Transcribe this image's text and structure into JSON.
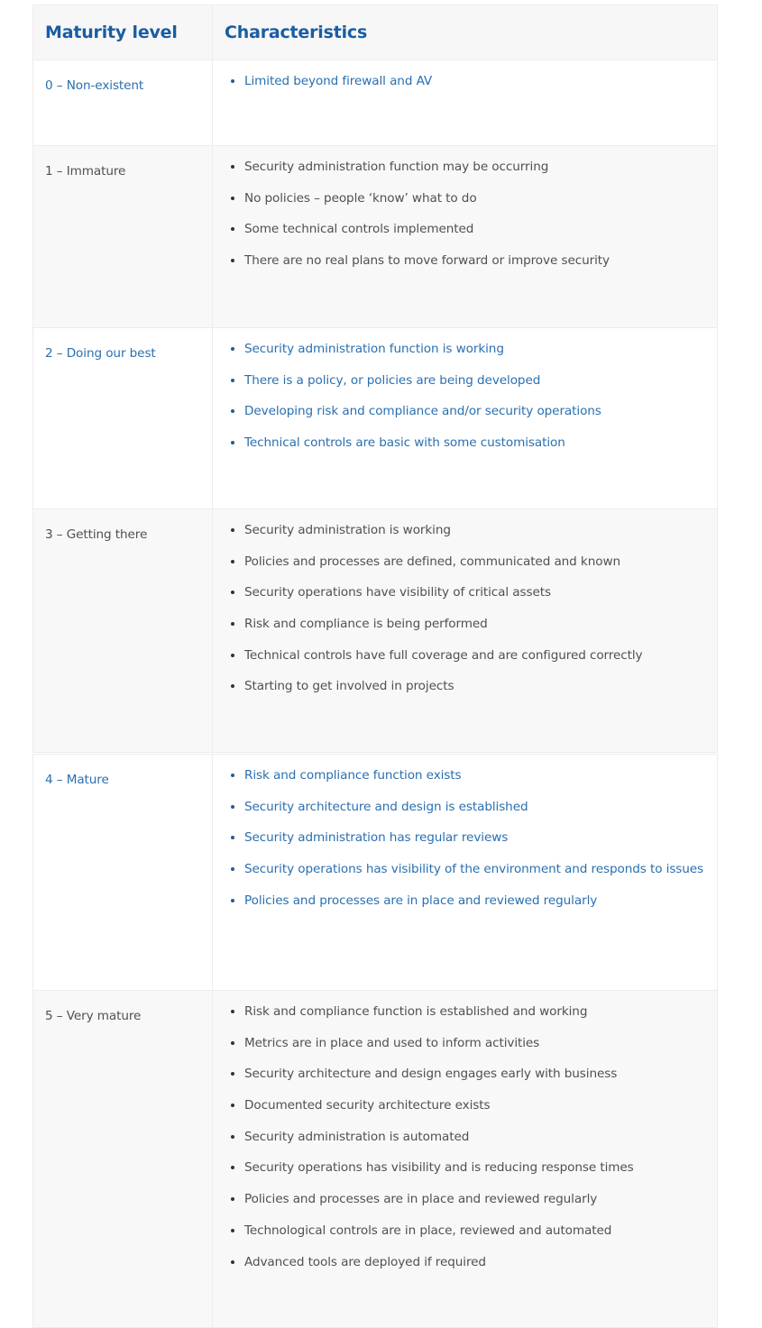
{
  "table": {
    "headers": {
      "level": "Maturity level",
      "characteristics": "Characteristics"
    },
    "rows": [
      {
        "level": "0 – Non-existent",
        "style": "blue",
        "items": [
          "Limited beyond firewall and AV"
        ]
      },
      {
        "level": "1 – Immature",
        "style": "gray",
        "items": [
          "Security administration function may be occurring",
          "No policies – people ‘know’ what to do",
          "Some technical controls implemented",
          "There are no real plans to move forward or improve security"
        ]
      },
      {
        "level": "2 – Doing our best",
        "style": "blue",
        "items": [
          "Security administration function is working",
          "There is a policy, or policies are being developed",
          "Developing risk and compliance and/or security operations",
          "Technical controls are basic with some customisation"
        ]
      },
      {
        "level": "3 – Getting there",
        "style": "gray",
        "items": [
          "Security administration is working",
          "Policies and processes are defined, communicated and known",
          "Security operations have visibility of critical assets",
          "Risk and compliance is being performed",
          "Technical controls have full coverage and are configured correctly",
          "Starting to get involved in projects"
        ]
      },
      {
        "level": "4 – Mature",
        "style": "blue",
        "items": [
          "Risk and compliance function exists",
          "Security architecture and design is established",
          "Security administration has regular reviews",
          "Security operations has visibility of the environment and responds to issues",
          "Policies and processes are in place and reviewed regularly"
        ]
      },
      {
        "level": "5 – Very mature",
        "style": "gray",
        "items": [
          "Risk and compliance function is established and working",
          "Metrics are in place and used to inform activities",
          "Security architecture and design engages early with business",
          "Documented security architecture exists",
          "Security administration is automated",
          "Security operations has visibility and is reducing response times",
          "Policies and processes are in place and reviewed regularly",
          "Technological controls are in place, reviewed and automated",
          "Advanced tools are deployed if required"
        ]
      }
    ],
    "colors": {
      "header_text": "#1a5da3",
      "link_blue": "#2a6fb0",
      "body_gray": "#505050",
      "border": "#ececec",
      "stripe": "#f8f8f8"
    }
  }
}
